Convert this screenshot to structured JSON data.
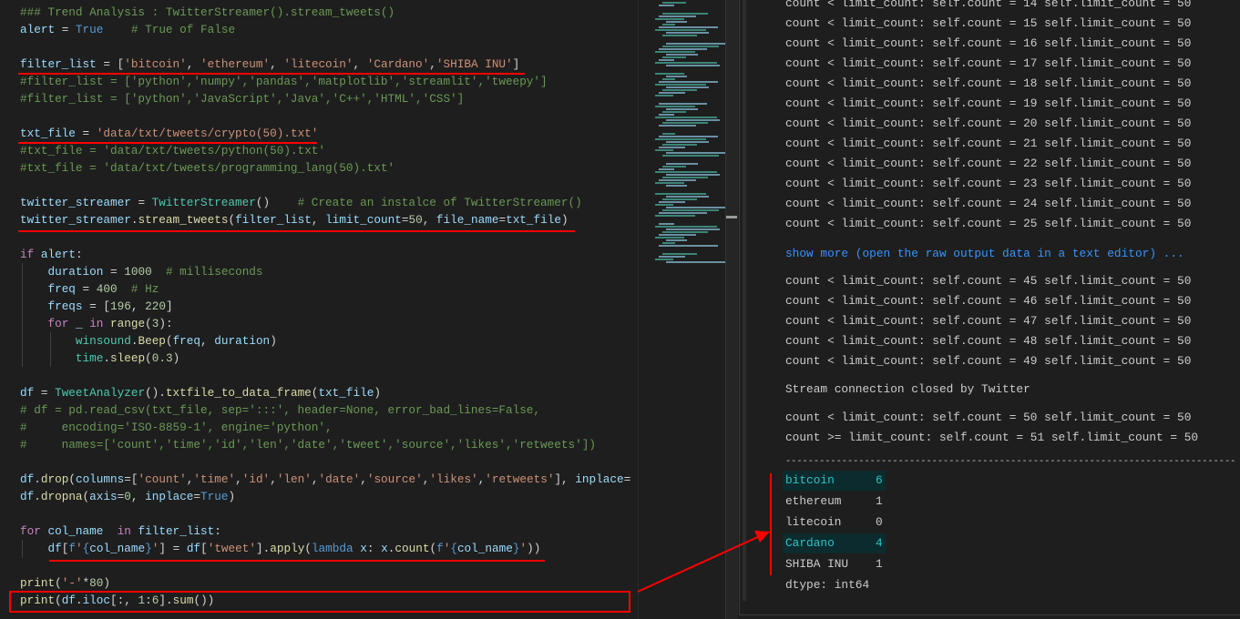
{
  "editor": {
    "lines": [
      [
        [
          "c",
          "### Trend Analysis : TwitterStreamer().stream_tweets()"
        ]
      ],
      [
        [
          "v",
          "alert"
        ],
        [
          "p",
          " = "
        ],
        [
          "b",
          "True"
        ],
        [
          "p",
          "    "
        ],
        [
          "c",
          "# True of False"
        ]
      ],
      [],
      [
        [
          "v",
          "filter_list"
        ],
        [
          "p",
          " = ["
        ],
        [
          "s",
          "'bitcoin'"
        ],
        [
          "p",
          ", "
        ],
        [
          "s",
          "'ethereum'"
        ],
        [
          "p",
          ", "
        ],
        [
          "s",
          "'litecoin'"
        ],
        [
          "p",
          ", "
        ],
        [
          "s",
          "'Cardano'"
        ],
        [
          "p",
          ","
        ],
        [
          "s",
          "'SHIBA INU'"
        ],
        [
          "p",
          "]"
        ]
      ],
      [
        [
          "c",
          "#filter_list = ['python','numpy','pandas','matplotlib','streamlit','tweepy']"
        ]
      ],
      [
        [
          "c",
          "#filter_list = ['python','JavaScript','Java','C++','HTML','CSS']"
        ]
      ],
      [],
      [
        [
          "v",
          "txt_file"
        ],
        [
          "p",
          " = "
        ],
        [
          "s",
          "'data/txt/tweets/crypto(50).txt'"
        ]
      ],
      [
        [
          "c",
          "#txt_file = 'data/txt/tweets/python(50).txt'"
        ]
      ],
      [
        [
          "c",
          "#txt_file = 'data/txt/tweets/programming_lang(50).txt'"
        ]
      ],
      [],
      [
        [
          "v",
          "twitter_streamer"
        ],
        [
          "p",
          " = "
        ],
        [
          "t",
          "TwitterStreamer"
        ],
        [
          "p",
          "()    "
        ],
        [
          "c",
          "# Create an instalce of TwitterStreamer()"
        ]
      ],
      [
        [
          "v",
          "twitter_streamer"
        ],
        [
          "p",
          "."
        ],
        [
          "f",
          "stream_tweets"
        ],
        [
          "p",
          "("
        ],
        [
          "v",
          "filter_list"
        ],
        [
          "p",
          ", "
        ],
        [
          "v",
          "limit_count"
        ],
        [
          "p",
          "="
        ],
        [
          "n",
          "50"
        ],
        [
          "p",
          ", "
        ],
        [
          "v",
          "file_name"
        ],
        [
          "p",
          "="
        ],
        [
          "v",
          "txt_file"
        ],
        [
          "p",
          ")"
        ]
      ],
      [],
      [
        [
          "k",
          "if"
        ],
        [
          "p",
          " "
        ],
        [
          "v",
          "alert"
        ],
        [
          "p",
          ":"
        ]
      ],
      [
        [
          "p",
          "    "
        ],
        [
          "v",
          "duration"
        ],
        [
          "p",
          " = "
        ],
        [
          "n",
          "1000"
        ],
        [
          "p",
          "  "
        ],
        [
          "c",
          "# milliseconds"
        ]
      ],
      [
        [
          "p",
          "    "
        ],
        [
          "v",
          "freq"
        ],
        [
          "p",
          " = "
        ],
        [
          "n",
          "400"
        ],
        [
          "p",
          "  "
        ],
        [
          "c",
          "# Hz"
        ]
      ],
      [
        [
          "p",
          "    "
        ],
        [
          "v",
          "freqs"
        ],
        [
          "p",
          " = ["
        ],
        [
          "n",
          "196"
        ],
        [
          "p",
          ", "
        ],
        [
          "n",
          "220"
        ],
        [
          "p",
          "]"
        ]
      ],
      [
        [
          "p",
          "    "
        ],
        [
          "k",
          "for"
        ],
        [
          "p",
          " "
        ],
        [
          "v",
          "_"
        ],
        [
          "p",
          " "
        ],
        [
          "k",
          "in"
        ],
        [
          "p",
          " "
        ],
        [
          "f",
          "range"
        ],
        [
          "p",
          "("
        ],
        [
          "n",
          "3"
        ],
        [
          "p",
          "):"
        ]
      ],
      [
        [
          "p",
          "        "
        ],
        [
          "t",
          "winsound"
        ],
        [
          "p",
          "."
        ],
        [
          "f",
          "Beep"
        ],
        [
          "p",
          "("
        ],
        [
          "v",
          "freq"
        ],
        [
          "p",
          ", "
        ],
        [
          "v",
          "duration"
        ],
        [
          "p",
          ")"
        ]
      ],
      [
        [
          "p",
          "        "
        ],
        [
          "t",
          "time"
        ],
        [
          "p",
          "."
        ],
        [
          "f",
          "sleep"
        ],
        [
          "p",
          "("
        ],
        [
          "n",
          "0.3"
        ],
        [
          "p",
          ")"
        ]
      ],
      [],
      [
        [
          "v",
          "df"
        ],
        [
          "p",
          " = "
        ],
        [
          "t",
          "TweetAnalyzer"
        ],
        [
          "p",
          "()."
        ],
        [
          "f",
          "txtfile_to_data_frame"
        ],
        [
          "p",
          "("
        ],
        [
          "v",
          "txt_file"
        ],
        [
          "p",
          ")"
        ]
      ],
      [
        [
          "c",
          "# df = pd.read_csv(txt_file, sep=':::', header=None, error_bad_lines=False,"
        ]
      ],
      [
        [
          "c",
          "#     encoding='ISO-8859-1', engine='python',"
        ]
      ],
      [
        [
          "c",
          "#     names=['count','time','id','len','date','tweet','source','likes','retweets'])"
        ]
      ],
      [],
      [
        [
          "v",
          "df"
        ],
        [
          "p",
          "."
        ],
        [
          "f",
          "drop"
        ],
        [
          "p",
          "("
        ],
        [
          "v",
          "columns"
        ],
        [
          "p",
          "=["
        ],
        [
          "s",
          "'count'"
        ],
        [
          "p",
          ","
        ],
        [
          "s",
          "'time'"
        ],
        [
          "p",
          ","
        ],
        [
          "s",
          "'id'"
        ],
        [
          "p",
          ","
        ],
        [
          "s",
          "'len'"
        ],
        [
          "p",
          ","
        ],
        [
          "s",
          "'date'"
        ],
        [
          "p",
          ","
        ],
        [
          "s",
          "'source'"
        ],
        [
          "p",
          ","
        ],
        [
          "s",
          "'likes'"
        ],
        [
          "p",
          ","
        ],
        [
          "s",
          "'retweets'"
        ],
        [
          "p",
          "], "
        ],
        [
          "v",
          "inplace"
        ],
        [
          "p",
          "="
        ]
      ],
      [
        [
          "v",
          "df"
        ],
        [
          "p",
          "."
        ],
        [
          "f",
          "dropna"
        ],
        [
          "p",
          "("
        ],
        [
          "v",
          "axis"
        ],
        [
          "p",
          "="
        ],
        [
          "n",
          "0"
        ],
        [
          "p",
          ", "
        ],
        [
          "v",
          "inplace"
        ],
        [
          "p",
          "="
        ],
        [
          "b",
          "True"
        ],
        [
          "p",
          ")"
        ]
      ],
      [],
      [
        [
          "k",
          "for"
        ],
        [
          "p",
          " "
        ],
        [
          "v",
          "col_name"
        ],
        [
          "p",
          "  "
        ],
        [
          "k",
          "in"
        ],
        [
          "p",
          " "
        ],
        [
          "v",
          "filter_list"
        ],
        [
          "p",
          ":"
        ]
      ],
      [
        [
          "p",
          "    "
        ],
        [
          "v",
          "df"
        ],
        [
          "p",
          "["
        ],
        [
          "b",
          "f"
        ],
        [
          "s",
          "'"
        ],
        [
          "b",
          "{"
        ],
        [
          "v",
          "col_name"
        ],
        [
          "b",
          "}"
        ],
        [
          "s",
          "'"
        ],
        [
          "p",
          "] = "
        ],
        [
          "v",
          "df"
        ],
        [
          "p",
          "["
        ],
        [
          "s",
          "'tweet'"
        ],
        [
          "p",
          "]."
        ],
        [
          "f",
          "apply"
        ],
        [
          "p",
          "("
        ],
        [
          "b",
          "lambda"
        ],
        [
          "p",
          " "
        ],
        [
          "v",
          "x"
        ],
        [
          "p",
          ": "
        ],
        [
          "v",
          "x"
        ],
        [
          "p",
          "."
        ],
        [
          "f",
          "count"
        ],
        [
          "p",
          "("
        ],
        [
          "b",
          "f"
        ],
        [
          "s",
          "'"
        ],
        [
          "b",
          "{"
        ],
        [
          "v",
          "col_name"
        ],
        [
          "b",
          "}"
        ],
        [
          "s",
          "'"
        ],
        [
          "p",
          "))"
        ]
      ],
      [],
      [
        [
          "f",
          "print"
        ],
        [
          "p",
          "("
        ],
        [
          "s",
          "'-'"
        ],
        [
          "p",
          "*"
        ],
        [
          "n",
          "80"
        ],
        [
          "p",
          ")"
        ]
      ],
      [
        [
          "f",
          "print"
        ],
        [
          "p",
          "("
        ],
        [
          "v",
          "df"
        ],
        [
          "p",
          "."
        ],
        [
          "v",
          "iloc"
        ],
        [
          "p",
          "[:, "
        ],
        [
          "n",
          "1"
        ],
        [
          "p",
          ":"
        ],
        [
          "n",
          "6"
        ],
        [
          "p",
          "]."
        ],
        [
          "f",
          "sum"
        ],
        [
          "p",
          "())"
        ]
      ]
    ]
  },
  "output": {
    "count_lines_top": [
      "count < limit_count: self.count = 14 self.limit_count = 50",
      "count < limit_count: self.count = 15 self.limit_count = 50",
      "count < limit_count: self.count = 16 self.limit_count = 50",
      "count < limit_count: self.count = 17 self.limit_count = 50",
      "count < limit_count: self.count = 18 self.limit_count = 50",
      "count < limit_count: self.count = 19 self.limit_count = 50",
      "count < limit_count: self.count = 20 self.limit_count = 50",
      "count < limit_count: self.count = 21 self.limit_count = 50",
      "count < limit_count: self.count = 22 self.limit_count = 50",
      "count < limit_count: self.count = 23 self.limit_count = 50",
      "count < limit_count: self.count = 24 self.limit_count = 50",
      "count < limit_count: self.count = 25 self.limit_count = 50"
    ],
    "show_more": "show more (open the raw output data in a text editor) ...",
    "count_lines_mid": [
      "count < limit_count: self.count = 45 self.limit_count = 50",
      "count < limit_count: self.count = 46 self.limit_count = 50",
      "count < limit_count: self.count = 47 self.limit_count = 50",
      "count < limit_count: self.count = 48 self.limit_count = 50",
      "count < limit_count: self.count = 49 self.limit_count = 50"
    ],
    "stream_closed": "Stream connection closed by Twitter",
    "final_lines": [
      "count < limit_count: self.count = 50 self.limit_count = 50",
      "count >= limit_count: self.count = 51 self.limit_count = 50"
    ],
    "separator": "--------------------------------------------------------------------------------",
    "series": [
      {
        "name": "bitcoin",
        "value": "6",
        "highlighted": true
      },
      {
        "name": "ethereum",
        "value": "1",
        "highlighted": false
      },
      {
        "name": "litecoin",
        "value": "0",
        "highlighted": false
      },
      {
        "name": "Cardano",
        "value": "4",
        "highlighted": true
      },
      {
        "name": "SHIBA INU",
        "value": "1",
        "highlighted": false
      }
    ],
    "dtype": "dtype: int64"
  },
  "colors": {
    "background": "#1e1e1e",
    "annotation": "#ff0000",
    "highlight_text": "#29c4c4",
    "link": "#3794ff"
  }
}
